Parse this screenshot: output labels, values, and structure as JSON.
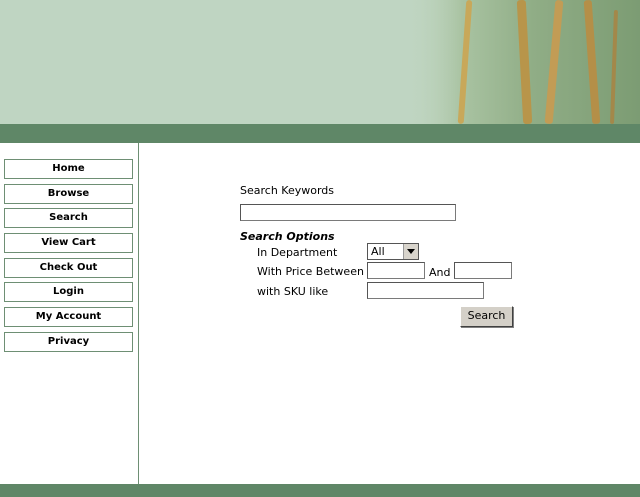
{
  "nav": {
    "items": [
      "Home",
      "Browse",
      "Search",
      "View Cart",
      "Check Out",
      "Login",
      "My Account",
      "Privacy"
    ]
  },
  "search": {
    "keywords_label": "Search Keywords",
    "keywords_value": "",
    "options_title": "Search Options",
    "department_label": "In Department",
    "department_value": "All",
    "price_label": "With Price Between",
    "price_and": "And",
    "price_min": "",
    "price_max": "",
    "sku_label": "with SKU like",
    "sku_value": "",
    "button_label": "Search"
  },
  "colors": {
    "header_bg": "#bfd5c2",
    "bar": "#5f8767",
    "nav_border": "#6e8f74"
  }
}
